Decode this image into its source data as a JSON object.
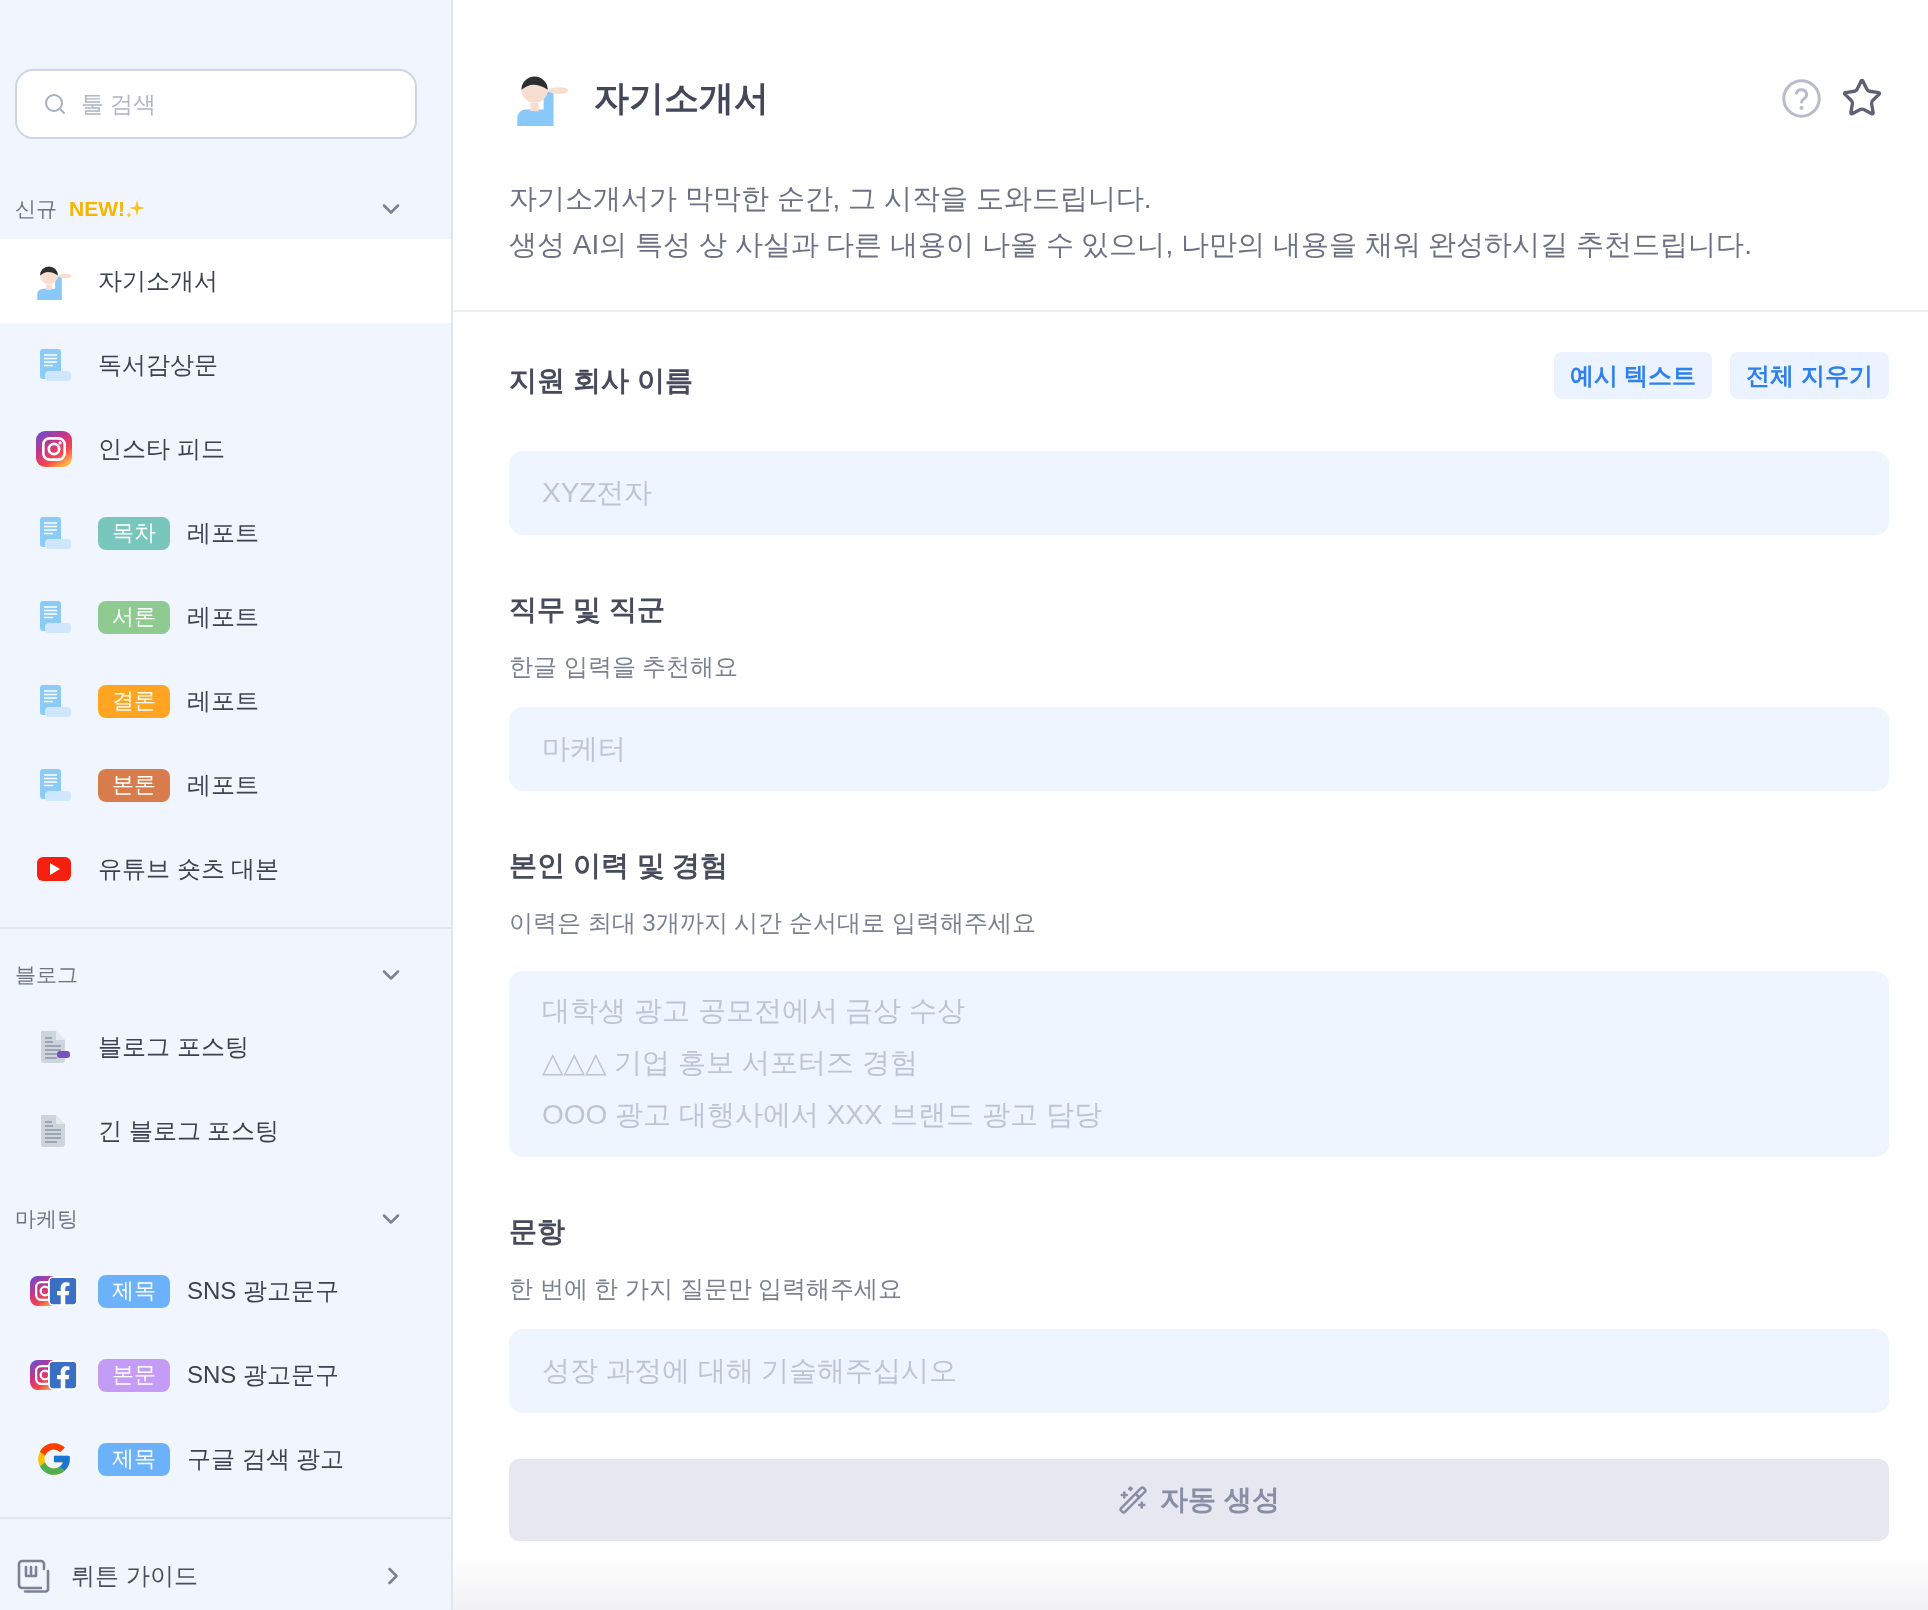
{
  "sidebar": {
    "search": {
      "placeholder": "툴 검색"
    },
    "groups": [
      {
        "sections": [
          {
            "title": "신규",
            "badge": "NEW!",
            "expanded": true,
            "items": [
              {
                "kind": "person",
                "label": "자기소개서",
                "selected": true
              },
              {
                "kind": "scroll",
                "label": "독서감상문",
                "selected": false
              },
              {
                "kind": "camera",
                "label": "인스타 피드",
                "selected": false
              },
              {
                "kind": "scroll",
                "tag": {
                  "label": "목차",
                  "color": "#79c6bd"
                },
                "label": "레포트",
                "selected": false
              },
              {
                "kind": "scroll",
                "tag": {
                  "label": "서론",
                  "color": "#8fcb91"
                },
                "label": "레포트",
                "selected": false
              },
              {
                "kind": "scroll",
                "tag": {
                  "label": "결론",
                  "color": "#ffa521"
                },
                "label": "레포트",
                "selected": false
              },
              {
                "kind": "scroll",
                "tag": {
                  "label": "본론",
                  "color": "#d97c4c"
                },
                "label": "레포트",
                "selected": false
              },
              {
                "kind": "play",
                "label": "유튜브 숏츠 대본",
                "selected": false
              }
            ]
          }
        ]
      },
      {
        "sections": [
          {
            "title": "블로그",
            "expanded": true,
            "items": [
              {
                "kind": "document_tab",
                "label": "블로그 포스팅",
                "selected": false
              },
              {
                "kind": "document",
                "label": "긴 블로그 포스팅",
                "selected": false
              }
            ]
          },
          {
            "title": "마케팅",
            "expanded": true,
            "items": [
              {
                "kind": "camera_f",
                "tag": {
                  "label": "제목",
                  "color": "#6cb2fb"
                },
                "label": "SNS 광고문구",
                "selected": false
              },
              {
                "kind": "camera_f",
                "tag": {
                  "label": "본문",
                  "color": "#c49cf6"
                },
                "label": "SNS 광고문구",
                "selected": false
              },
              {
                "kind": "g_logo",
                "tag": {
                  "label": "제목",
                  "color": "#6cb2fb"
                },
                "label": "구글 검색 광고",
                "selected": false
              }
            ]
          }
        ]
      }
    ],
    "guide": {
      "label": "뤼튼 가이드"
    }
  },
  "tool": {
    "title": "자기소개서",
    "favorite": false,
    "description": [
      "자기소개서가 막막한 순간, 그 시작을 도와드립니다.",
      "생성 AI의 특성 상 사실과 다른 내용이 나올 수 있으니, 나만의 내용을 채워 완성하시길 추천드립니다."
    ]
  },
  "form": {
    "actions": [
      {
        "label": "예시 텍스트"
      },
      {
        "label": "전체 지우기"
      }
    ],
    "fields": [
      {
        "label": "지원 회사 이름",
        "kind": "input",
        "placeholder": "XYZ전자"
      },
      {
        "label": "직무 및 직군",
        "hint": "한글 입력을 추천해요",
        "kind": "input",
        "placeholder": "마케터"
      },
      {
        "label": "본인 이력 및 경험",
        "hint": "이력은 최대 3개까지 시간 순서대로 입력해주세요",
        "kind": "textarea",
        "placeholder": "대학생 광고 공모전에서 금상 수상\n△△△ 기업 홍보 서포터즈 경험\nOOO 광고 대행사에서 XXX 브랜드 광고 담당"
      },
      {
        "label": "문항",
        "hint": "한 번에 한 가지 질문만 입력해주세요",
        "kind": "input",
        "placeholder": "성장 과정에 대해 기술해주십시오"
      }
    ],
    "submit": {
      "label": "자동 생성",
      "disabled": true
    }
  }
}
